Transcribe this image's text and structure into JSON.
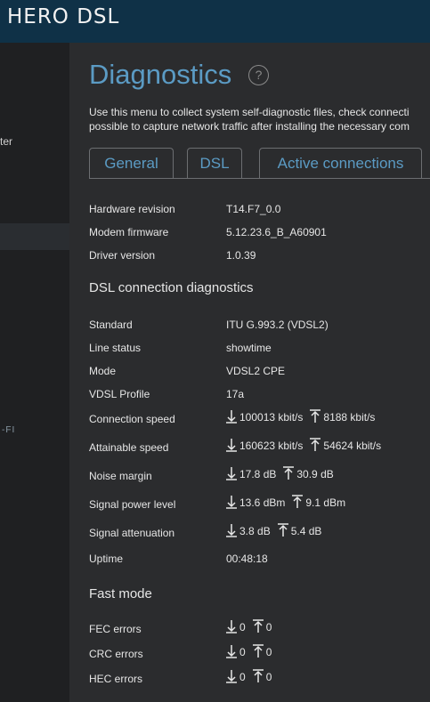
{
  "header": {
    "brand": "HERO DSL"
  },
  "sidebar": {
    "item_partial": "ter",
    "wifi_partial": "-FI"
  },
  "page": {
    "title": "Diagnostics",
    "help": "?",
    "description_line1": "Use this menu to collect system self-diagnostic files, check connecti",
    "description_line2": "possible to capture network traffic after installing the necessary com"
  },
  "tabs": [
    {
      "label": "General",
      "active": false
    },
    {
      "label": "DSL",
      "active": true
    },
    {
      "label": "Active connections",
      "active": false
    }
  ],
  "hardware": [
    {
      "label": "Hardware revision",
      "value": "T14.F7_0.0"
    },
    {
      "label": "Modem firmware",
      "value": "5.12.23.6_B_A60901"
    },
    {
      "label": "Driver version",
      "value": "1.0.39"
    }
  ],
  "dsl_section_title": "DSL connection diagnostics",
  "dsl": [
    {
      "label": "Standard",
      "value": "ITU G.993.2 (VDSL2)"
    },
    {
      "label": "Line status",
      "value": "showtime"
    },
    {
      "label": "Mode",
      "value": "VDSL2 CPE"
    },
    {
      "label": "VDSL Profile",
      "value": "17a"
    }
  ],
  "dsl_dir": [
    {
      "label": "Connection speed",
      "down": "100013 kbit/s",
      "up": "8188 kbit/s"
    },
    {
      "label": "Attainable speed",
      "down": "160623 kbit/s",
      "up": "54624 kbit/s"
    },
    {
      "label": "Noise margin",
      "down": "17.8 dB",
      "up": "30.9 dB"
    },
    {
      "label": "Signal power level",
      "down": "13.6 dBm",
      "up": "9.1 dBm"
    },
    {
      "label": "Signal attenuation",
      "down": "3.8 dB",
      "up": "5.4 dB"
    }
  ],
  "uptime": {
    "label": "Uptime",
    "value": "00:48:18"
  },
  "fast_section_title": "Fast mode",
  "fast": [
    {
      "label": "FEC errors",
      "down": "0",
      "up": "0"
    },
    {
      "label": "CRC errors",
      "down": "0",
      "up": "0"
    },
    {
      "label": "HEC errors",
      "down": "0",
      "up": "0"
    }
  ],
  "colors": {
    "accent": "#5b9bc4",
    "header": "#0f3147",
    "sidebar": "#1f2022",
    "background": "#2b2c2e"
  }
}
